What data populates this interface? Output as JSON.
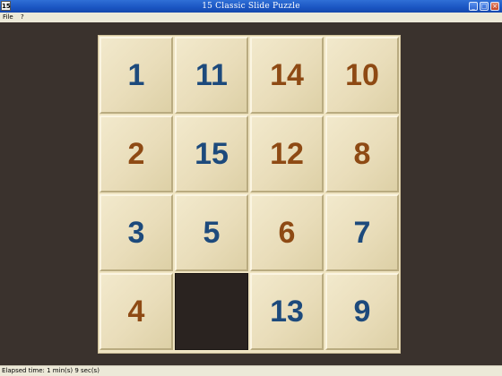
{
  "window": {
    "app_icon_text": "15",
    "title": "15 Classic Slide Puzzle",
    "minimize_glyph": "_",
    "maximize_glyph": "□",
    "close_glyph": "×"
  },
  "menu": [
    {
      "label": "File"
    },
    {
      "label": "?"
    }
  ],
  "board": {
    "tiles": [
      {
        "value": "1",
        "color": "blue"
      },
      {
        "value": "11",
        "color": "blue"
      },
      {
        "value": "14",
        "color": "brown"
      },
      {
        "value": "10",
        "color": "brown"
      },
      {
        "value": "2",
        "color": "brown"
      },
      {
        "value": "15",
        "color": "blue"
      },
      {
        "value": "12",
        "color": "brown"
      },
      {
        "value": "8",
        "color": "brown"
      },
      {
        "value": "3",
        "color": "blue"
      },
      {
        "value": "5",
        "color": "blue"
      },
      {
        "value": "6",
        "color": "brown"
      },
      {
        "value": "7",
        "color": "blue"
      },
      {
        "value": "4",
        "color": "brown"
      },
      {
        "value": "",
        "color": "empty"
      },
      {
        "value": "13",
        "color": "blue"
      },
      {
        "value": "9",
        "color": "blue"
      }
    ],
    "colors": {
      "blue": "#1d4a7c",
      "brown": "#8e4a14",
      "empty": "#2a2320"
    }
  },
  "status": {
    "elapsed": "Elapsed time: 1 min(s) 9 sec(s)"
  }
}
